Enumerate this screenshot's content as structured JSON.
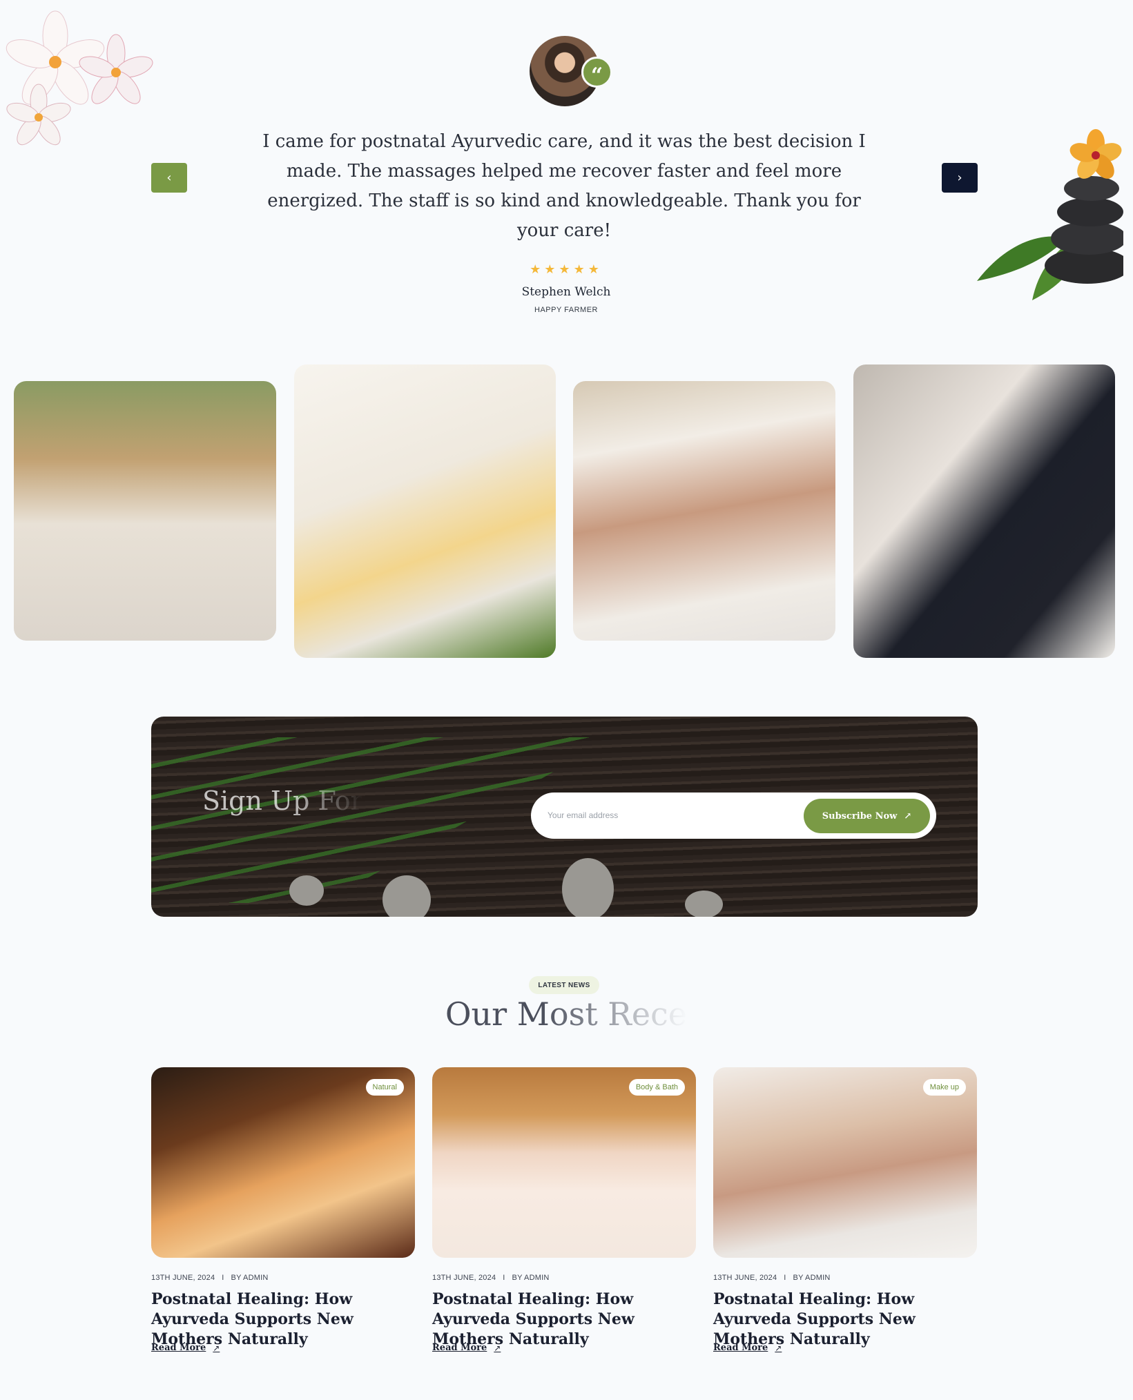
{
  "colors": {
    "accent": "#7a9a45",
    "navy": "#0e1730",
    "star": "#f4b83a"
  },
  "testimonial": {
    "quote": "I came for postnatal Ayurvedic care, and it was the best decision I made. The massages helped me recover faster and feel more energized. The staff is so kind and knowledgeable. Thank you for your care!",
    "rating": 5,
    "stars": "★★★★★",
    "name": "Stephen Welch",
    "role": "HAPPY FARMER",
    "quote_icon": "quote-icon",
    "prev_icon": "chevron-left-icon",
    "next_icon": "chevron-right-icon",
    "prev_glyph": "‹",
    "next_glyph": "›",
    "quote_glyph": "“"
  },
  "newsletter": {
    "title": "Sign Up For",
    "placeholder": "Your email address",
    "button_label": "Subscribe Now",
    "button_icon": "arrow-up-right-icon",
    "arrow_glyph": "↗"
  },
  "news": {
    "pill": "LATEST NEWS",
    "heading": "Our Most Rece",
    "cards": [
      {
        "tag": "Natural",
        "date": "13TH JUNE, 2024",
        "sep": "I",
        "author": "BY ADMIN",
        "title": "Postnatal Healing: How Ayurveda Supports New Mothers Naturally",
        "read_more": "Read More"
      },
      {
        "tag": "Body & Bath",
        "date": "13TH JUNE, 2024",
        "sep": "I",
        "author": "BY ADMIN",
        "title": "Postnatal Healing: How Ayurveda Supports New Mothers Naturally",
        "read_more": "Read More"
      },
      {
        "tag": "Make up",
        "date": "13TH JUNE, 2024",
        "sep": "I",
        "author": "BY ADMIN",
        "title": "Postnatal Healing: How Ayurveda Supports New Mothers Naturally",
        "read_more": "Read More"
      }
    ]
  }
}
